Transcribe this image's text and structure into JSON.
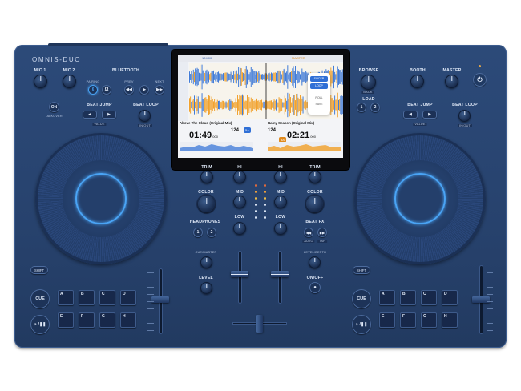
{
  "brand": "OMNIS-DUO",
  "left": {
    "mic1": "MIC 1",
    "mic2": "MIC 2",
    "bluetooth": "BLUETOOTH",
    "bt_pairing": "PAIRING",
    "bt_prev": "PREV",
    "bt_next": "NEXT",
    "on": "ON",
    "talkover": "TALKOVER",
    "beat_jump": "BEAT JUMP",
    "value": "VALUE",
    "beat_loop": "BEAT LOOP",
    "in_out": "IN/OUT"
  },
  "right": {
    "browse": "BROWSE",
    "back": "BACK",
    "load": "LOAD",
    "load_1": "1",
    "load_2": "2",
    "booth": "BOOTH",
    "master": "MASTER",
    "beat_jump": "BEAT JUMP",
    "value": "VALUE",
    "beat_loop": "BEAT LOOP",
    "in_out": "IN/OUT"
  },
  "mixer": {
    "trim": "TRIM",
    "hi": "HI",
    "mid": "MID",
    "low": "LOW",
    "color": "COLOR",
    "headphones": "HEADPHONES",
    "hp_1": "1",
    "hp_2": "2",
    "cue_master": "CUE/MASTER",
    "level": "LEVEL",
    "beat_fx": "BEAT FX",
    "auto": "AUTO",
    "tap": "TAP",
    "level_depth": "LEVEL/DEPTH",
    "on_off": "ON/OFF"
  },
  "decks": [
    {
      "shift": "SHIFT",
      "cue": "CUE",
      "cue_sub": "CUE",
      "play": "►/❚❚",
      "pads": [
        "A",
        "B",
        "C",
        "D",
        "E",
        "F",
        "G",
        "H"
      ]
    },
    {
      "shift": "SHIFT",
      "cue": "CUE",
      "cue_sub": "CUE",
      "play": "►/❚❚",
      "pads": [
        "A",
        "B",
        "C",
        "D",
        "E",
        "F",
        "G",
        "H"
      ]
    }
  ],
  "screen": {
    "track_a": {
      "title": "Above The Cloud (Original Mix)",
      "time": "01:49",
      "time_ms": ".000",
      "bpm": "124",
      "key": "5A"
    },
    "track_b": {
      "title": "Rainy Season (Original Mix)",
      "time": "02:21",
      "time_ms": ".000",
      "bpm": "124",
      "key": "8A"
    },
    "popup": [
      "SLICER",
      "LOOP",
      "ROLL",
      "SAVE"
    ],
    "header_a": "124.00",
    "header_b": "MASTER"
  },
  "colors": {
    "body": "#27426d",
    "jog_ring": "#4aa4f5",
    "waveform_blue": "#2f6fd6",
    "waveform_orange": "#f19a1a"
  },
  "icons": {
    "power": "power-icon",
    "headphone": "headphone-icon",
    "prev": "skip-back-icon",
    "next": "skip-forward-icon"
  }
}
